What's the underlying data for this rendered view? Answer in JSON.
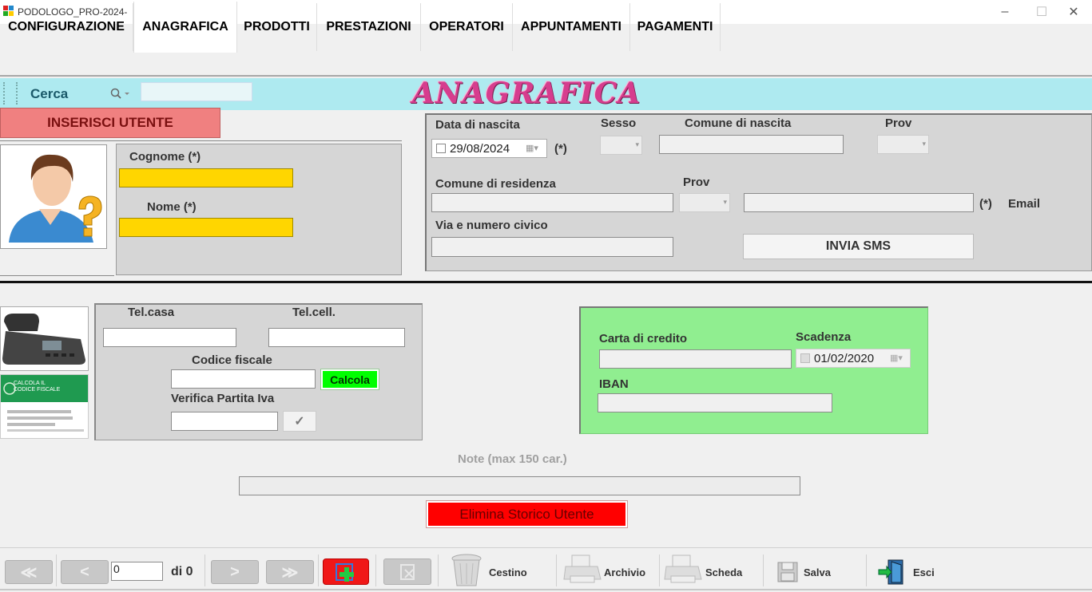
{
  "window": {
    "title": "PODOLOGO_PRO-2024-",
    "minimize": "–",
    "maximize": "☐",
    "close": "✕"
  },
  "tabs": [
    {
      "label": "CONFIGURAZIONE"
    },
    {
      "label": "ANAGRAFICA"
    },
    {
      "label": "PRODOTTI"
    },
    {
      "label": "PRESTAZIONI"
    },
    {
      "label": "OPERATORI"
    },
    {
      "label": "APPUNTAMENTI"
    },
    {
      "label": "PAGAMENTI"
    }
  ],
  "active_tab": "ANAGRAFICA",
  "search": {
    "label": "Cerca",
    "value": ""
  },
  "header_title": "ANAGRAFICA",
  "insert_button": "INSERISCI  UTENTE",
  "person": {
    "cognome_label": "Cognome   (*)",
    "cognome_value": "",
    "nome_label": "Nome   (*)",
    "nome_value": ""
  },
  "birth": {
    "data_label": "Data di nascita",
    "data_value": "29/08/2024",
    "required_mark": "(*)",
    "sesso_label": "Sesso",
    "comune_label": "Comune di nascita",
    "prov_label": "Prov"
  },
  "residence": {
    "comune_label": "Comune di residenza",
    "prov_label": "Prov",
    "via_label": "Via e numero civico",
    "email_required": "(*)",
    "email_label": "Email",
    "sms_button": "INVIA  SMS"
  },
  "contacts": {
    "tel_casa_label": "Tel.casa",
    "tel_cell_label": "Tel.cell.",
    "cf_label": "Codice fiscale",
    "calcola_button": "Calcola",
    "piva_label": "Verifica Partita Iva",
    "check_glyph": "✓",
    "cf_image_title": "CALCOLA IL CODICE FISCALE"
  },
  "payment": {
    "carta_label": "Carta di credito",
    "scadenza_label": "Scadenza",
    "scadenza_value": "01/02/2020",
    "iban_label": "IBAN"
  },
  "notes": {
    "label": "Note (max 150 car.)",
    "value": ""
  },
  "delete_history_button": "Elimina Storico Utente",
  "navigator": {
    "first": "≪",
    "prev": "<",
    "position": "0",
    "of_label": "di 0",
    "next": ">",
    "last": "≫",
    "cestino": "Cestino",
    "archivio": "Archivio",
    "scheda": "Scheda",
    "salva": "Salva",
    "esci": "Esci"
  },
  "colors": {
    "cerca_bar": "#aeeaf0",
    "insert_button": "#f08080",
    "required_field": "#ffd600",
    "payment_panel": "#90ee90",
    "calcola": "#00ff00",
    "delete_button": "#ff0000",
    "title_text": "#d63d8e"
  }
}
